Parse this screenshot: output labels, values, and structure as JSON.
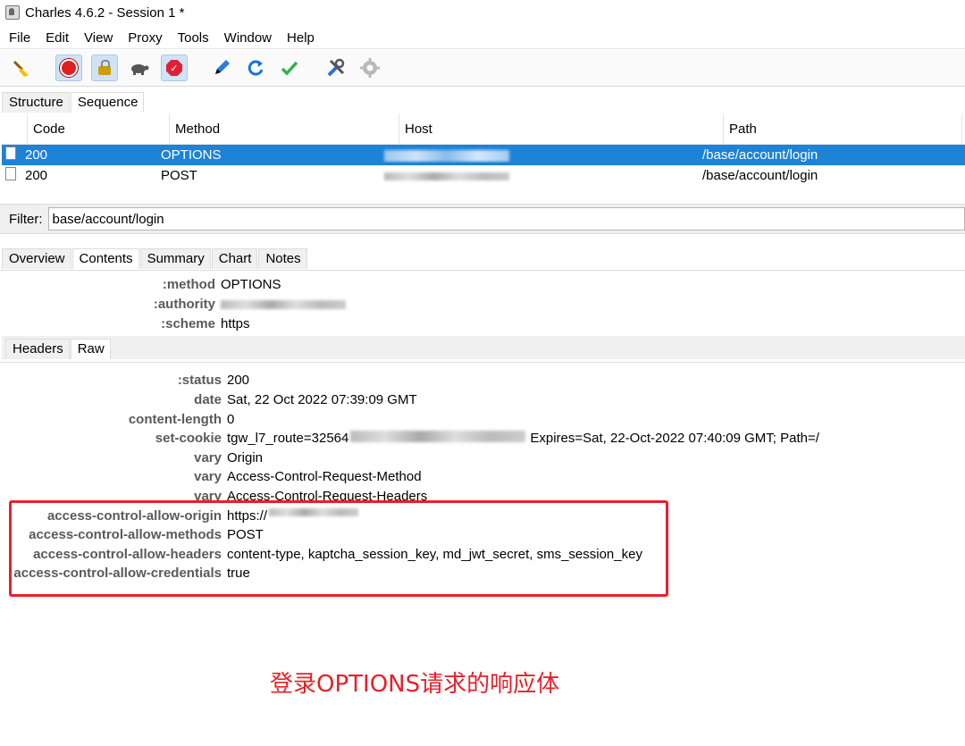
{
  "window": {
    "title": "Charles 4.6.2 - Session 1 *"
  },
  "menu": [
    "File",
    "Edit",
    "View",
    "Proxy",
    "Tools",
    "Window",
    "Help"
  ],
  "toolbar": {
    "icons": [
      "broom-icon",
      "record-icon",
      "ssl-lock-icon",
      "turtle-throttle-icon",
      "breakpoint-stop-icon",
      "pen-compose-icon",
      "refresh-icon",
      "checkmark-icon",
      "tools-icon",
      "settings-gear-icon"
    ]
  },
  "view_tabs": [
    "Structure",
    "Sequence"
  ],
  "view_tab_selected": "Sequence",
  "table": {
    "columns": [
      "Code",
      "Method",
      "Host",
      "Path"
    ],
    "rows": [
      {
        "code": "200",
        "method": "OPTIONS",
        "path": "/base/account/login",
        "selected": true
      },
      {
        "code": "200",
        "method": "POST",
        "path": "/base/account/login",
        "selected": false
      }
    ]
  },
  "filter": {
    "label": "Filter:",
    "value": "base/account/login"
  },
  "detail_tabs": [
    "Overview",
    "Contents",
    "Summary",
    "Chart",
    "Notes"
  ],
  "detail_tab_selected": "Contents",
  "request_headers": [
    {
      "key": ":method",
      "value": "OPTIONS"
    },
    {
      "key": ":authority",
      "value": ""
    },
    {
      "key": ":scheme",
      "value": "https"
    }
  ],
  "header_tabs": [
    "Headers",
    "Raw"
  ],
  "header_tab_selected": "Headers",
  "response_headers": [
    {
      "key": ":status",
      "value": "200"
    },
    {
      "key": "date",
      "value": "Sat, 22 Oct 2022 07:39:09 GMT"
    },
    {
      "key": "content-length",
      "value": "0"
    },
    {
      "key": "set-cookie",
      "value": "tgw_l7_route=32564",
      "value_tail": "Expires=Sat, 22-Oct-2022 07:40:09 GMT; Path=/"
    },
    {
      "key": "vary",
      "value": "Origin"
    },
    {
      "key": "vary",
      "value": "Access-Control-Request-Method"
    },
    {
      "key": "vary",
      "value": "Access-Control-Request-Headers"
    },
    {
      "key": "access-control-allow-origin",
      "value": "https://"
    },
    {
      "key": "access-control-allow-methods",
      "value": "POST"
    },
    {
      "key": "access-control-allow-headers",
      "value": "content-type, kaptcha_session_key, md_jwt_secret, sms_session_key"
    },
    {
      "key": "access-control-allow-credentials",
      "value": "true"
    }
  ],
  "annotation": {
    "caption": "登录OPTIONS请求的响应体",
    "color": "#e8202a"
  }
}
